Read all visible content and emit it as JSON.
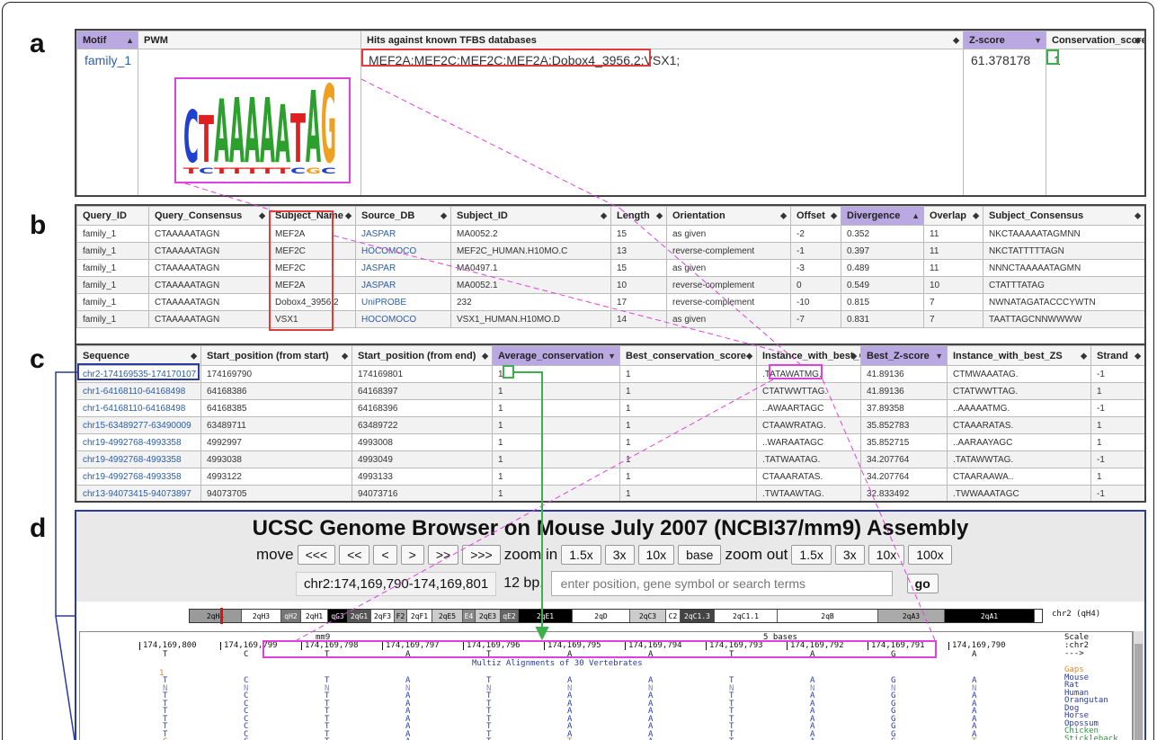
{
  "labels": {
    "a": "a",
    "b": "b",
    "c": "c",
    "d": "d"
  },
  "colors": {
    "sorted_header": "#b9a8e2",
    "highlight_red": "#e23b3b",
    "highlight_green": "#3ab14a",
    "highlight_magenta": "#e040e0",
    "highlight_blue": "#2a3ca0",
    "link": "#2a5ea8"
  },
  "panel_a": {
    "headers": [
      "Motif",
      "PWM",
      "Hits against known TFBS databases",
      "Z-score",
      "Conservation_score"
    ],
    "row": {
      "motif": "family_1",
      "hits": "MEF2A;MEF2C;MEF2C;MEF2A;Dobox4_3956.2;VSX1;",
      "zscore": "61.378178",
      "conservation": "1"
    },
    "logo_letters": [
      "C",
      "T",
      "A",
      "A",
      "A",
      "A",
      "A",
      "T",
      "A",
      "G"
    ]
  },
  "panel_b": {
    "headers": [
      "Query_ID",
      "Query_Consensus",
      "Subject_Name",
      "Source_DB",
      "Subject_ID",
      "Length",
      "Orientation",
      "Offset",
      "Divergence",
      "Overlap",
      "Subject_Consensus"
    ],
    "rows": [
      [
        "family_1",
        "CTAAAAATAGN",
        "MEF2A",
        "JASPAR",
        "MA0052.2",
        "15",
        "as given",
        "-2",
        "0.352",
        "11",
        "NKCTAAAAATAGMNN"
      ],
      [
        "family_1",
        "CTAAAAATAGN",
        "MEF2C",
        "HOCOMOCO",
        "MEF2C_HUMAN.H10MO.C",
        "13",
        "reverse-complement",
        "-1",
        "0.397",
        "11",
        "NKCTATTTTTAGN"
      ],
      [
        "family_1",
        "CTAAAAATAGN",
        "MEF2C",
        "JASPAR",
        "MA0497.1",
        "15",
        "as given",
        "-3",
        "0.489",
        "11",
        "NNNCTAAAAATAGMN"
      ],
      [
        "family_1",
        "CTAAAAATAGN",
        "MEF2A",
        "JASPAR",
        "MA0052.1",
        "10",
        "reverse-complement",
        "0",
        "0.549",
        "10",
        "CTATTTATAG"
      ],
      [
        "family_1",
        "CTAAAAATAGN",
        "Dobox4_3956.2",
        "UniPROBE",
        "232",
        "17",
        "reverse-complement",
        "-10",
        "0.815",
        "7",
        "NWNATAGATACCCYWTN"
      ],
      [
        "family_1",
        "CTAAAAATAGN",
        "VSX1",
        "HOCOMOCO",
        "VSX1_HUMAN.H10MO.D",
        "14",
        "as given",
        "-7",
        "0.831",
        "7",
        "TAATTAGCNNWWWW"
      ]
    ]
  },
  "panel_c": {
    "headers": [
      "Sequence",
      "Start_position (from start)",
      "Start_position (from end)",
      "Average_conservation",
      "Best_conservation_score",
      "Instance_with_best_CS",
      "Best_Z-score",
      "Instance_with_best_ZS",
      "Strand"
    ],
    "rows": [
      [
        "chr2-174169535-174170107",
        "174169790",
        "174169801",
        "1",
        "1",
        ".TATAWATMG.",
        "41.89136",
        "CTMWAAATAG.",
        "-1"
      ],
      [
        "chr1-64168110-64168498",
        "64168386",
        "64168397",
        "1",
        "1",
        "CTATWWTTAG.",
        "41.89136",
        "CTATWWTTAG.",
        "1"
      ],
      [
        "chr1-64168110-64168498",
        "64168385",
        "64168396",
        "1",
        "1",
        "..AWAARTAGC",
        "37.89358",
        "..AAAAATMG.",
        "-1"
      ],
      [
        "chr15-63489277-63490009",
        "63489711",
        "63489722",
        "1",
        "1",
        "CTAAWRATAG.",
        "35.852783",
        "CTAAARATAS.",
        "1"
      ],
      [
        "chr19-4992768-4993358",
        "4992997",
        "4993008",
        "1",
        "1",
        "..WARAATAGC",
        "35.852715",
        "..AARAAYAGC",
        "1"
      ],
      [
        "chr19-4992768-4993358",
        "4993038",
        "4993049",
        "1",
        "1",
        ".TATWAATAG.",
        "34.207764",
        ".TATAWWTAG.",
        "-1"
      ],
      [
        "chr19-4992768-4993358",
        "4993122",
        "4993133",
        "1",
        "1",
        "CTAAARATAS.",
        "34.207764",
        "CTAARAAWA..",
        "1"
      ],
      [
        "chr13-94073415-94073897",
        "94073705",
        "94073716",
        "1",
        "1",
        ".TWTAAWTAG.",
        "32.833492",
        ".TWWAAATAGC",
        "-1"
      ]
    ]
  },
  "panel_d": {
    "title": "UCSC Genome Browser on Mouse July 2007 (NCBI37/mm9) Assembly",
    "move_label": "move",
    "move_buttons": [
      "<<<",
      "<<",
      "<",
      ">",
      ">>",
      ">>>"
    ],
    "zoom_in_label": "zoom in",
    "zoom_in_buttons": [
      "1.5x",
      "3x",
      "10x",
      "base"
    ],
    "zoom_out_label": "zoom out",
    "zoom_out_buttons": [
      "1.5x",
      "3x",
      "10x",
      "100x"
    ],
    "position": "chr2:174,169,790-174,169,801",
    "size": "12 bp.",
    "search_placeholder": "enter position, gene symbol or search terms",
    "go": "go",
    "ideogram": [
      "2qH4",
      "2qH3",
      "qH2",
      "2qH1",
      "qG3",
      "2qG1",
      "2qF3",
      "F2",
      "2qF1",
      "2qE5",
      "E4",
      "2qE3",
      "qE2",
      "2qE1",
      "2qD",
      "2qC3",
      "C2",
      "2qC1.3",
      "2qC1.1",
      "2qB",
      "2qA3",
      "2qA1"
    ],
    "ideogram_label": "chr2 (qH4)",
    "scale_label": "mm9",
    "bases_label": "5 bases",
    "coords": [
      "174,169,800",
      "174,169,799",
      "174,169,798",
      "174,169,797",
      "174,169,796",
      "174,169,795",
      "174,169,794",
      "174,169,793",
      "174,169,792",
      "174,169,791",
      "174,169,790"
    ],
    "ref_seq": [
      "T",
      "C",
      "T",
      "A",
      "T",
      "A",
      "A",
      "T",
      "A",
      "G",
      "A"
    ],
    "multiz": "Multiz Alignments of 30 Vertebrates",
    "right_labels": [
      "Scale",
      ":chr2",
      "--->",
      "Gaps",
      "Mouse",
      "Rat",
      "Human",
      "Orangutan",
      "Dog",
      "Horse",
      "Opossum",
      "Chicken",
      "Stickleback"
    ],
    "align_rows": [
      [
        "T",
        "C",
        "T",
        "A",
        "T",
        "A",
        "A",
        "T",
        "A",
        "G",
        "A"
      ],
      [
        "N",
        "N",
        "N",
        "N",
        "N",
        "N",
        "N",
        "N",
        "N",
        "N",
        "N"
      ],
      [
        "T",
        "C",
        "T",
        "A",
        "T",
        "A",
        "A",
        "T",
        "A",
        "G",
        "A"
      ],
      [
        "T",
        "C",
        "T",
        "A",
        "T",
        "A",
        "A",
        "T",
        "A",
        "G",
        "A"
      ],
      [
        "T",
        "C",
        "T",
        "A",
        "T",
        "A",
        "A",
        "T",
        "A",
        "G",
        "A"
      ],
      [
        "T",
        "C",
        "T",
        "A",
        "T",
        "A",
        "A",
        "T",
        "A",
        "G",
        "A"
      ],
      [
        "T",
        "C",
        "T",
        "A",
        "T",
        "A",
        "A",
        "T",
        "A",
        "G",
        "A"
      ],
      [
        "T",
        "C",
        "T",
        "A",
        "T",
        "A",
        "A",
        "T",
        "A",
        "G",
        "A"
      ],
      [
        "C",
        "C",
        "T",
        "A",
        "T",
        "T",
        "A",
        "T",
        "A",
        "G",
        "T"
      ]
    ],
    "gap_mark": "1"
  }
}
